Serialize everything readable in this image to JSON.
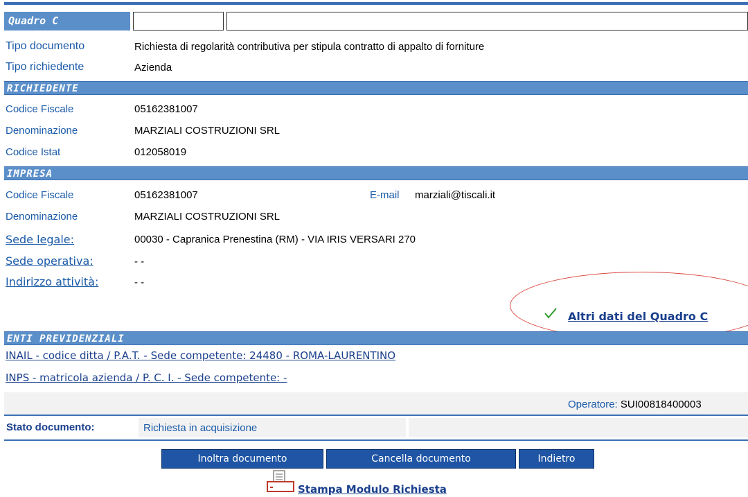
{
  "quadro": {
    "title": "Quadro C"
  },
  "documento": {
    "tipo_documento_label": "Tipo documento",
    "tipo_documento_value": "Richiesta di regolarità contributiva per stipula contratto di appalto di forniture",
    "tipo_richiedente_label": "Tipo richiedente",
    "tipo_richiedente_value": "Azienda"
  },
  "richiedente": {
    "section_title": "RICHIEDENTE",
    "codice_fiscale_label": "Codice Fiscale",
    "codice_fiscale_value": "05162381007",
    "denominazione_label": "Denominazione",
    "denominazione_value": "MARZIALI COSTRUZIONI SRL",
    "codice_istat_label": "Codice Istat",
    "codice_istat_value": "012058019"
  },
  "impresa": {
    "section_title": "IMPRESA",
    "codice_fiscale_label": "Codice Fiscale",
    "codice_fiscale_value": "05162381007",
    "email_label": "E-mail",
    "email_value": "marziali@tiscali.it",
    "denominazione_label": "Denominazione",
    "denominazione_value": "MARZIALI COSTRUZIONI SRL",
    "sede_legale_label": "Sede legale:",
    "sede_legale_value": "00030 - Capranica Prenestina (RM) - VIA IRIS VERSARI 270",
    "sede_operativa_label": "Sede operativa:",
    "sede_operativa_value": "- -",
    "indirizzo_attivita_label": "Indirizzo attività:",
    "indirizzo_attivita_value": "- -",
    "altri_dati_link": "Altri dati del Quadro C",
    "check_icon": "check-icon"
  },
  "enti": {
    "section_title": "ENTI PREVIDENZIALI",
    "inail_link": "INAIL - codice ditta / P.A.T. - Sede competente: 24480 - ROMA-LAURENTINO",
    "inps_link": "INPS - matricola azienda / P. C. I. - Sede competente: -",
    "operatore_label": "Operatore:",
    "operatore_value": "SUI00818400003"
  },
  "stato": {
    "label": "Stato documento:",
    "value": "Richiesta in acquisizione"
  },
  "buttons": {
    "inoltra": "Inoltra documento",
    "cancella": "Cancella documento",
    "indietro": "Indietro"
  },
  "stampa": {
    "label": "Stampa Modulo Richiesta",
    "icon": "printer-icon"
  },
  "colors": {
    "section_bar": "#5b8fc9",
    "button": "#1f55a4",
    "highlight_oval": "#d9443c",
    "check": "#2e9a2e"
  }
}
